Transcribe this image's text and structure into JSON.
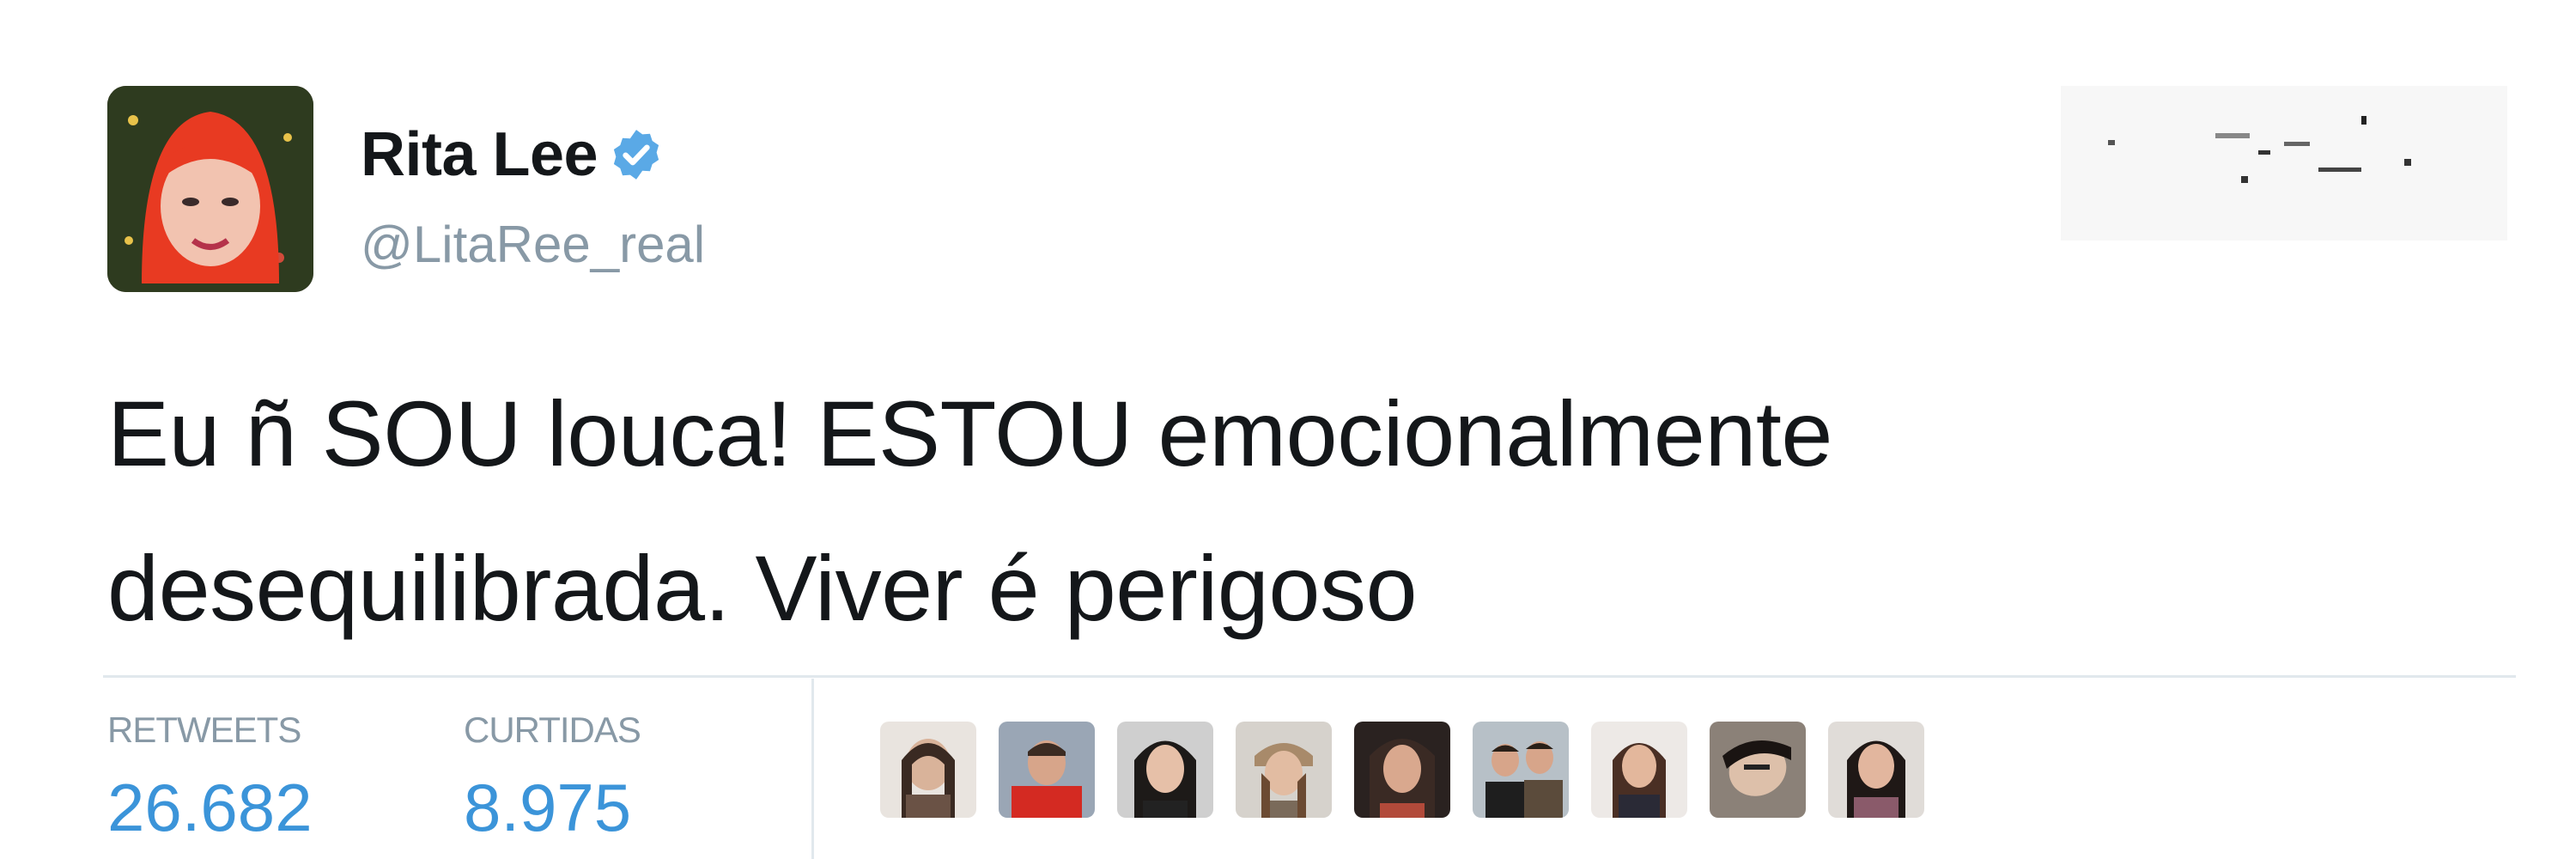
{
  "author": {
    "display_name": "Rita Lee",
    "handle": "@LitaRee_real",
    "verified": true,
    "verified_icon": "verified-badge-icon"
  },
  "tweet": {
    "text_line_1": "Eu ñ SOU louca! ESTOU emocionalmente",
    "text_line_2": "desequilibrada. Viver é perigoso"
  },
  "stats": {
    "retweets_label": "RETWEETS",
    "retweets_value": "26.682",
    "likes_label": "CURTIDAS",
    "likes_value": "8.975"
  },
  "likers": [
    {
      "name": "liker-avatar-1"
    },
    {
      "name": "liker-avatar-2"
    },
    {
      "name": "liker-avatar-3"
    },
    {
      "name": "liker-avatar-4"
    },
    {
      "name": "liker-avatar-5"
    },
    {
      "name": "liker-avatar-6"
    },
    {
      "name": "liker-avatar-7"
    },
    {
      "name": "liker-avatar-8"
    },
    {
      "name": "liker-avatar-9"
    }
  ],
  "colors": {
    "text": "#14171a",
    "muted": "#8899a6",
    "accent": "#3b94d9",
    "verified": "#1da1f2",
    "divider": "#e1e8ed"
  }
}
